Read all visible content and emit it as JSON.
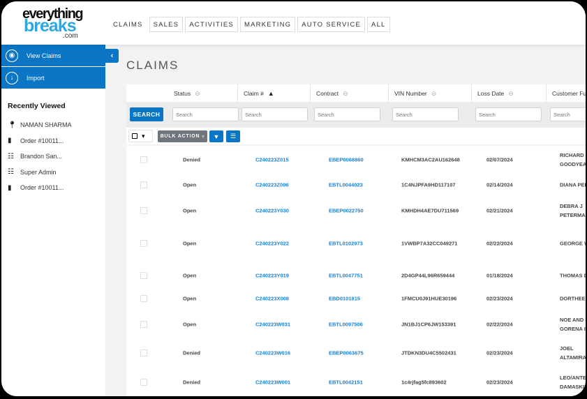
{
  "brand": {
    "line1": "everything",
    "line2": "breaks",
    "line3": ".com"
  },
  "nav": [
    "CLAIMS",
    "SALES",
    "ACTIVITIES",
    "MARKETING",
    "AUTO SERVICE",
    "ALL"
  ],
  "sidebar": {
    "items": [
      {
        "label": "View Claims",
        "icon": "eye-icon"
      },
      {
        "label": "Import",
        "icon": "download-icon"
      }
    ],
    "recent_title": "Recently Viewed",
    "recent": [
      {
        "label": "NAMAN SHARMA",
        "icon": "map-pin-icon"
      },
      {
        "label": "Order #10011...",
        "icon": "document-icon"
      },
      {
        "label": "Brandon San...",
        "icon": "list-question-icon"
      },
      {
        "label": "Super Admin",
        "icon": "list-question-icon"
      },
      {
        "label": "Order #10011...",
        "icon": "document-icon"
      }
    ]
  },
  "page_title": "CLAIMS",
  "table": {
    "columns": [
      "Status",
      "Claim #",
      "Contract",
      "VIN Number",
      "Loss Date",
      "Customer Ful"
    ],
    "search_button": "SEARCH",
    "search_placeholder": "Search",
    "bulk_action": "BULK ACTION",
    "rows": [
      [
        "Denied",
        "C240223Z015",
        "EBEP0068860",
        "KMHCM3AC2AU162648",
        "02/07/2024",
        "RICHARD\nGOODYEAR"
      ],
      [
        "Open",
        "C240223Z006",
        "EBTL0044023",
        "1C4NJPFA9HD117107",
        "02/14/2024",
        "DIANA PER"
      ],
      [
        "Open",
        "C240223Y030",
        "EBEP0022750",
        "KMHDH4AE7DU711569",
        "02/21/2024",
        "DEBRA J\nPETERMAN"
      ],
      [
        "Open",
        "C240223Y022",
        "EBTL0102973",
        "1VWBP7A32CC049271",
        "02/22/2024",
        "GEORGE W"
      ],
      [
        "Open",
        "C240223Y019",
        "EBTL0047751",
        "2D4GP44L96R659444",
        "01/18/2024",
        "THOMAS D"
      ],
      [
        "Open",
        "C240223X008",
        "EBD0101815",
        "1FMCU0J91HUE30196",
        "02/23/2024",
        "DORTHEE I"
      ],
      [
        "Open",
        "C240223W031",
        "EBTL0097506",
        "JN1BJ1CP6JW153391",
        "02/22/2024",
        "NOE AND F\nGORENA II"
      ],
      [
        "Denied",
        "C240223W016",
        "EBEP0063675",
        "JTDKN3DU4C5502431",
        "02/23/2024",
        "JOEL\nALTAMIRA"
      ],
      [
        "Denied",
        "C240223W001",
        "EBTL0042151",
        "1c4rjfag5fc893602",
        "02/23/2024",
        "LEO/ANTE\nDAMASKIN"
      ]
    ]
  },
  "colors": {
    "accent": "#0b76c5",
    "link": "#1a7fd0",
    "logo_blue": "#2ba8e0"
  }
}
